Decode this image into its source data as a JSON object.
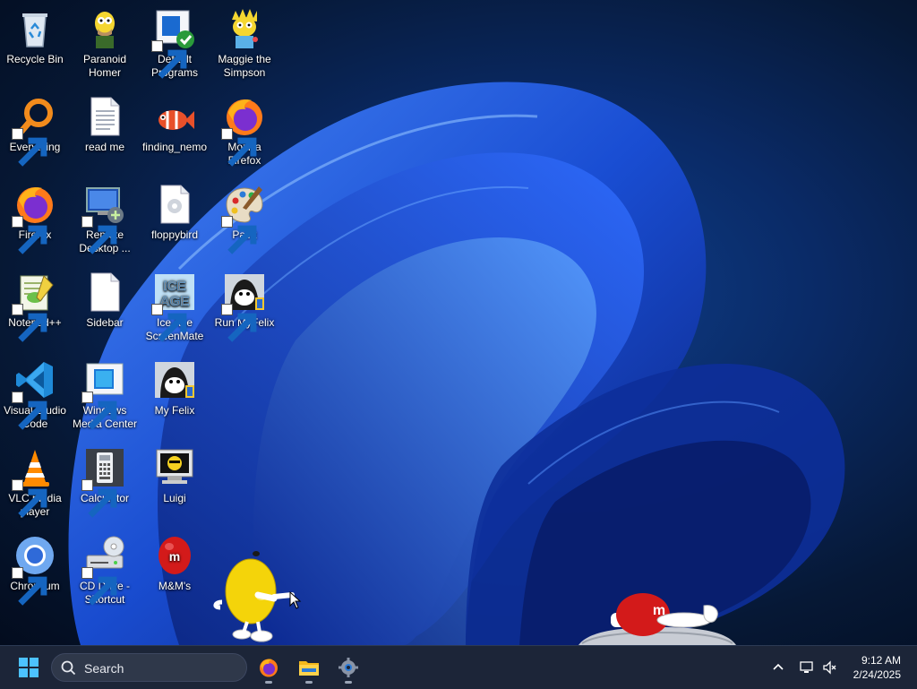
{
  "desktop": {
    "icons": [
      {
        "label": "Recycle Bin"
      },
      {
        "label": "Paranoid Homer"
      },
      {
        "label": "Default Programs"
      },
      {
        "label": "Maggie the Simpson"
      },
      {
        "label": "Everything"
      },
      {
        "label": "read me"
      },
      {
        "label": "finding_nemo"
      },
      {
        "label": "Mozilla Firefox"
      },
      {
        "label": "Firefox"
      },
      {
        "label": "Remote Desktop ..."
      },
      {
        "label": "floppybird"
      },
      {
        "label": "Paint"
      },
      {
        "label": "Notepad++"
      },
      {
        "label": "Sidebar"
      },
      {
        "label": "Ice Age ScreenMate"
      },
      {
        "label": "Run MyFelix"
      },
      {
        "label": "Visual Studio Code"
      },
      {
        "label": "Windows Media Center"
      },
      {
        "label": "My Felix"
      },
      {
        "label": "VLC media player"
      },
      {
        "label": "Calculator"
      },
      {
        "label": "Luigi"
      },
      {
        "label": "Chromium"
      },
      {
        "label": "CD Drive - Shortcut"
      },
      {
        "label": "M&M's"
      }
    ]
  },
  "taskbar": {
    "search_placeholder": "Search",
    "start_icon": "windows-logo-icon",
    "pinned": [
      {
        "name": "firefox-icon",
        "running": true
      },
      {
        "name": "file-explorer-icon",
        "running": true
      },
      {
        "name": "settings-gear-icon",
        "running": true
      }
    ],
    "clock": {
      "time": "9:12 AM",
      "date": "2/24/2025"
    }
  },
  "colors": {
    "taskbar_bg": "#1c2538",
    "wallpaper_accent": "#1a56e0",
    "mm_red": "#d31a1a",
    "mm_yellow": "#f4d40a"
  }
}
